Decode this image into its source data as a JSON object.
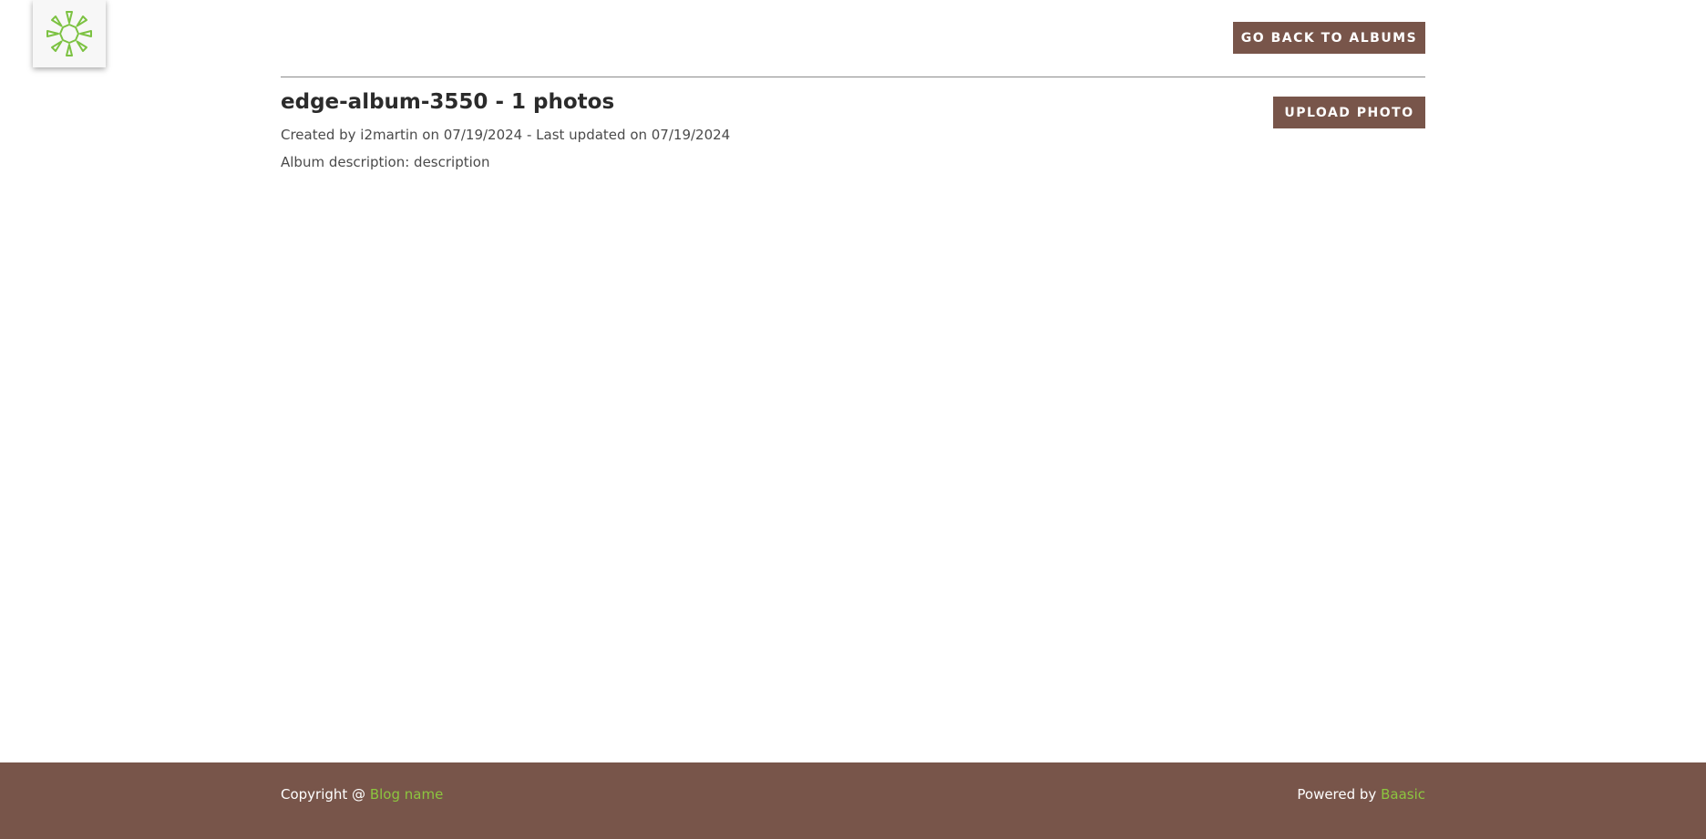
{
  "logo": {
    "icon": "sun-logo-icon",
    "color": "#7cc242"
  },
  "header": {
    "back_label": "GO BACK TO ALBUMS"
  },
  "album": {
    "title": "edge-album-3550 - 1 photos",
    "meta": "Created by i2martin on 07/19/2024 - Last updated on 07/19/2024",
    "description": "Album description: description",
    "upload_label": "UPLOAD PHOTO"
  },
  "footer": {
    "copyright_prefix": "Copyright @ ",
    "blog_name": "Blog name",
    "powered_prefix": "Powered by ",
    "powered_link": "Baasic",
    "bg_color": "#78554a",
    "link_color": "#8cc63f"
  }
}
